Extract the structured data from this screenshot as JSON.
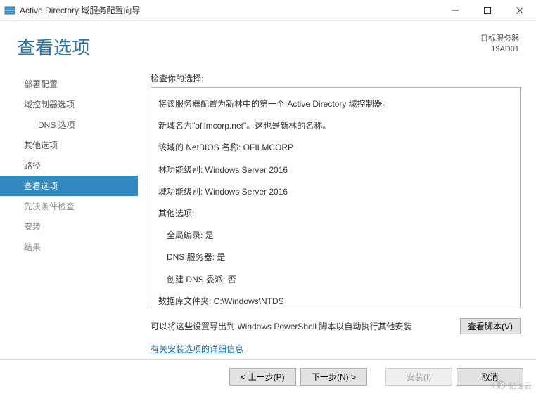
{
  "titlebar": {
    "title": "Active Directory 域服务配置向导"
  },
  "header": {
    "page_title": "查看选项",
    "target_label": "目标服务器",
    "target_value": "19AD01"
  },
  "sidebar": {
    "items": [
      {
        "label": "部署配置",
        "state": "done"
      },
      {
        "label": "域控制器选项",
        "state": "done"
      },
      {
        "label": "DNS 选项",
        "state": "done",
        "sub": true
      },
      {
        "label": "其他选项",
        "state": "done"
      },
      {
        "label": "路径",
        "state": "done"
      },
      {
        "label": "查看选项",
        "state": "active"
      },
      {
        "label": "先决条件检查",
        "state": "future"
      },
      {
        "label": "安装",
        "state": "future"
      },
      {
        "label": "结果",
        "state": "future"
      }
    ]
  },
  "content": {
    "review_label": "检查你的选择:",
    "lines": [
      {
        "text": "将该服务器配置为新林中的第一个 Active Directory 域控制器。"
      },
      {
        "text": "新域名为\"ofilmcorp.net\"。这也是新林的名称。"
      },
      {
        "text": "该域的 NetBIOS 名称: OFILMCORP"
      },
      {
        "text": "林功能级别: Windows Server 2016"
      },
      {
        "text": "域功能级别: Windows Server 2016"
      },
      {
        "text": "其他选项:"
      },
      {
        "text": "全局编录: 是",
        "indent": true
      },
      {
        "text": "DNS 服务器: 是",
        "indent": true
      },
      {
        "text": "创建 DNS 委派: 否",
        "indent": true
      },
      {
        "text": "数据库文件夹: C:\\Windows\\NTDS"
      }
    ],
    "export_text": "可以将这些设置导出到 Windows PowerShell 脚本以自动执行其他安装",
    "view_script_btn": "查看脚本(V)",
    "more_link": "有关安装选项的详细信息"
  },
  "footer": {
    "prev": "< 上一步(P)",
    "next": "下一步(N) >",
    "install": "安装(I)",
    "cancel": "取消"
  },
  "watermark": "亿速云"
}
